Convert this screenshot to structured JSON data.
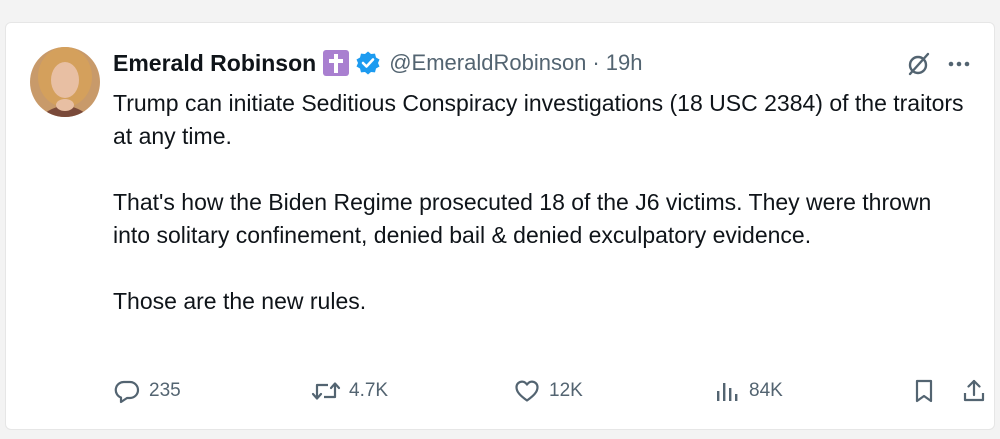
{
  "tweet": {
    "author_name": "Emerald Robinson",
    "handle": "@EmeraldRobinson",
    "separator": "·",
    "time": "19h",
    "paragraphs": [
      "Trump can initiate Seditious Conspiracy investigations (18 USC 2384) of the traitors at any time.",
      "That's how the Biden Regime prosecuted 18 of the J6 victims. They were thrown into solitary confinement, denied bail & denied exculpatory evidence.",
      "Those are the new rules."
    ]
  },
  "stats": {
    "replies": "235",
    "reposts": "4.7K",
    "likes": "12K",
    "views": "84K"
  },
  "icons": {
    "name_badge": "latin-cross-icon",
    "verified": "verified-badge-icon",
    "grok": "grok-icon",
    "more": "more-icon",
    "reply": "reply-icon",
    "repost": "repost-icon",
    "like": "heart-icon",
    "views": "views-icon",
    "bookmark": "bookmark-icon",
    "share": "share-icon"
  },
  "colors": {
    "verified": "#1d9bf0",
    "cross_badge": "#a97fd0",
    "secondary_text": "#536471"
  }
}
